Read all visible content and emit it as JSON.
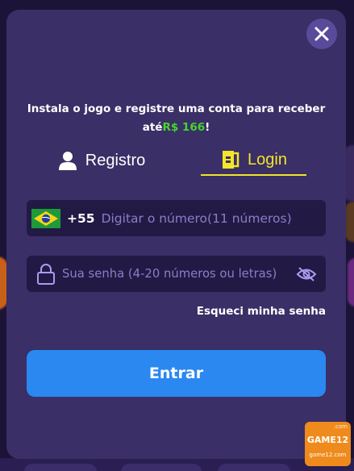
{
  "modal": {
    "promo_text": "Instala o jogo e registre uma conta para receber",
    "promo_prefix": "até",
    "promo_amount": "R$ 166",
    "promo_suffix": "!"
  },
  "tabs": {
    "register_label": "Registro",
    "login_label": "Login",
    "active": "Login"
  },
  "phone": {
    "country_code": "+55",
    "placeholder": "Digitar o número(11 números)",
    "value": ""
  },
  "password": {
    "placeholder": "Sua senha (4-20 números ou letras)",
    "value": ""
  },
  "forgot_label": "Esqueci minha senha",
  "submit_label": "Entrar",
  "watermark": {
    "top": ".com",
    "name": "GAME12",
    "site": "game12.com"
  },
  "colors": {
    "modal_bg": "#3a2f66",
    "field_bg": "#221a45",
    "accent_yellow": "#f3e52a",
    "amount_green": "#46d42c",
    "button_blue": "#2a88f0",
    "placeholder": "#8a7ec6"
  },
  "icons": {
    "close": "close-icon",
    "register": "user-icon",
    "login": "login-door-icon",
    "flag": "brazil-flag-icon",
    "lock": "lock-icon",
    "eye": "eye-slash-icon"
  }
}
